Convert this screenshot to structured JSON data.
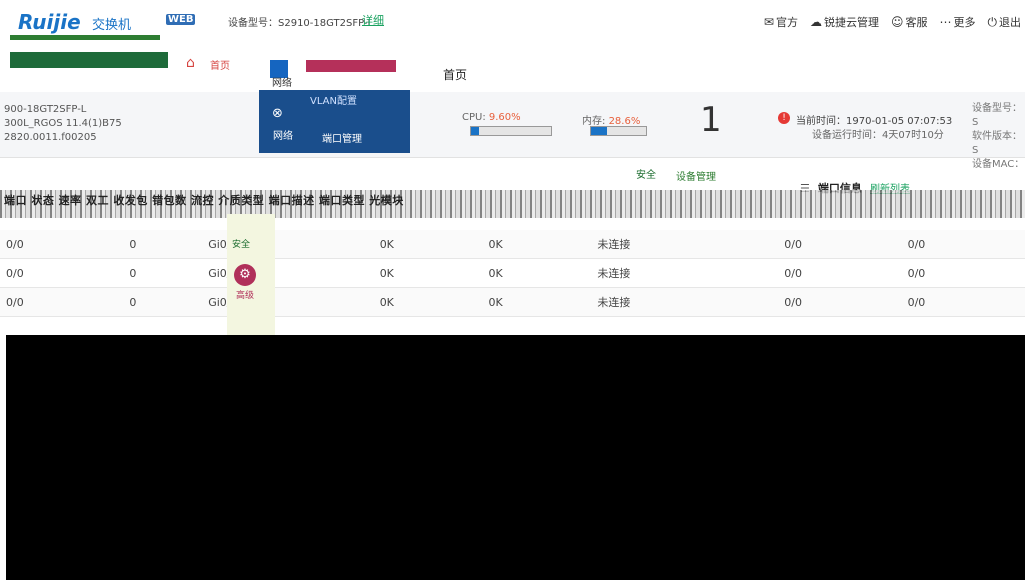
{
  "header": {
    "logo": "Ruijie",
    "logo_sub": "交换机",
    "web_tag": "WEB",
    "device_model_prefix": "设备型号：",
    "device_model": "S2910-18GT2SFP-L",
    "detail_link": "详细",
    "right_items": [
      {
        "icon": "chat-icon",
        "label": "官方"
      },
      {
        "icon": "cloud-icon",
        "label": "锐捷云管理"
      },
      {
        "icon": "user-icon",
        "label": "客服"
      },
      {
        "icon": "more-icon",
        "label": "更多"
      },
      {
        "icon": "logout-icon",
        "label": "退出"
      }
    ]
  },
  "nav": {
    "home_label": "首页",
    "network_label": "网络",
    "page_title": "首页"
  },
  "overview": {
    "model_lines": [
      "900-18GT2SFP-L",
      "300L_RGOS 11.4(1)B75",
      "2820.0011.f00205"
    ],
    "side_menu_title": "VLAN配置",
    "side_menu_item1": "网络",
    "side_menu_item2": "端口管理",
    "cpu_label": "CPU:",
    "cpu_value": "9.60%",
    "cpu_percent": 9.6,
    "memory_label": "内存:",
    "memory_value": "28.6%",
    "memory_percent": 28.6,
    "alarm_count": "1",
    "time_label": "当前时间：",
    "time_value": "1970-01-05 07:07:53",
    "runtime_label": "设备运行时间：",
    "runtime_value": "4天07时10分",
    "right_model_label": "设备型号：S",
    "right_version_label": "软件版本：S",
    "right_mac_label": "设备MAC："
  },
  "port_panel": {
    "security_label": "安全",
    "mgmt_label": "设备管理",
    "title": "端口信息",
    "refresh_link": "刷新列表",
    "scrambled_header": "端口  状态  速率  双工  收发包  错包数  流控  介质类型  端口描述  端口类型  光模块"
  },
  "menu_side": {
    "label": "高级",
    "top_label": "安全"
  },
  "port_rows": [
    [
      "0/0",
      "0",
      "Gi0/1",
      "0K",
      "0K",
      "未连接",
      "0/0",
      "0/0"
    ],
    [
      "0/0",
      "0",
      "Gi0/2",
      "0K",
      "0K",
      "未连接",
      "0/0",
      "0/0"
    ],
    [
      "0/0",
      "0",
      "Gi0/3",
      "0K",
      "0K",
      "未连接",
      "0/0",
      "0/0"
    ]
  ],
  "colors": {
    "brand_blue": "#1a73c6",
    "alarm_red": "#e53935",
    "link_green": "#1aa260"
  }
}
